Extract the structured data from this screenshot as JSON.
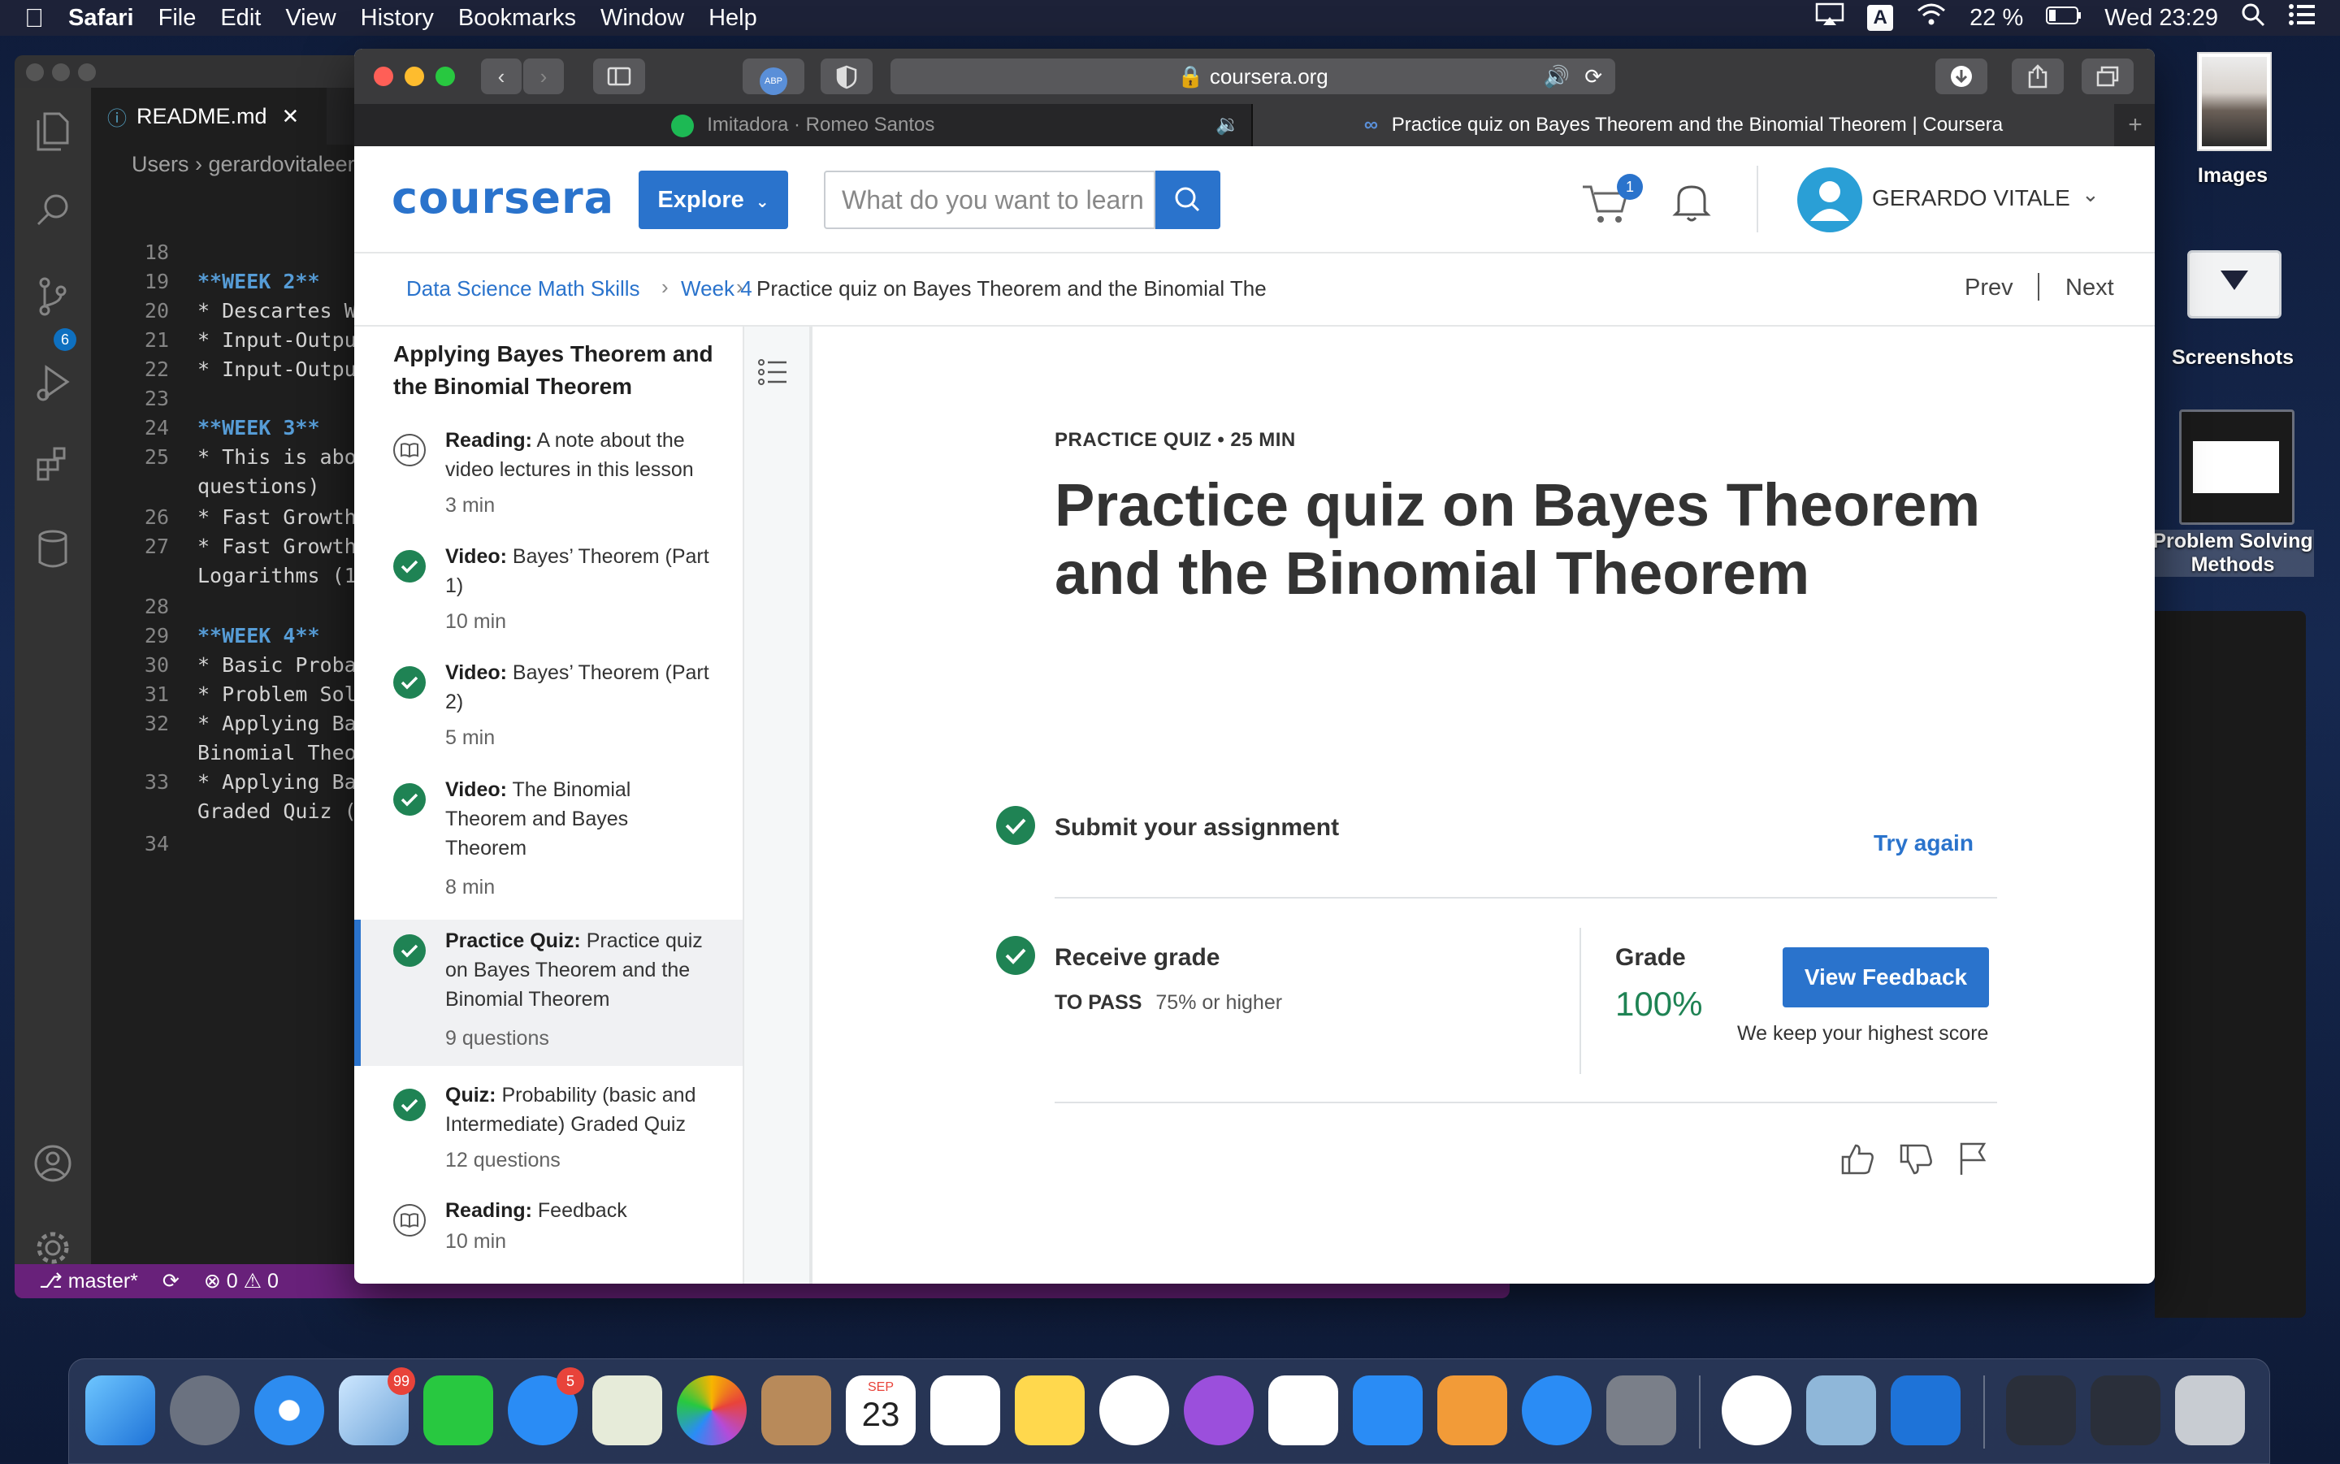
{
  "menubar": {
    "app": "Safari",
    "items": [
      "File",
      "Edit",
      "View",
      "History",
      "Bookmarks",
      "Window",
      "Help"
    ],
    "battery": "22 %",
    "datetime": "Wed 23:29"
  },
  "vscode": {
    "tab_title": "README.md",
    "breadcrumb": "Users › gerardovitaleern",
    "lines": [
      {
        "n": "18",
        "t": "",
        "h": false
      },
      {
        "n": "19",
        "t": "**WEEK 2**",
        "h": true
      },
      {
        "n": "20",
        "t": "* Descartes Wa",
        "h": false
      },
      {
        "n": "21",
        "t": "* Input-Outpu",
        "h": false
      },
      {
        "n": "22",
        "t": "* Input-Outpu",
        "h": false
      },
      {
        "n": "23",
        "t": "",
        "h": false
      },
      {
        "n": "24",
        "t": "**WEEK 3**",
        "h": true
      },
      {
        "n": "25",
        "t": "* This is abo",
        "h": false
      },
      {
        "n": "",
        "t": "questions)",
        "h": false
      },
      {
        "n": "26",
        "t": "* Fast Growth",
        "h": false
      },
      {
        "n": "27",
        "t": "* Fast Growth",
        "h": false
      },
      {
        "n": "",
        "t": "Logarithms (1",
        "h": false
      },
      {
        "n": "28",
        "t": "",
        "h": false
      },
      {
        "n": "29",
        "t": "**WEEK 4**",
        "h": true
      },
      {
        "n": "30",
        "t": "* Basic Probal",
        "h": false
      },
      {
        "n": "31",
        "t": "* Problem Sol",
        "h": false
      },
      {
        "n": "32",
        "t": "* Applying Ba",
        "h": false
      },
      {
        "n": "",
        "t": "Binomial Theo",
        "h": false
      },
      {
        "n": "33",
        "t": "* Applying Ba",
        "h": false
      },
      {
        "n": "",
        "t": "Graded Quiz (",
        "h": false
      },
      {
        "n": "34",
        "t": "",
        "h": false
      }
    ],
    "status_branch": "master*",
    "status_problems": "⊗ 0 ⚠ 0",
    "scm_badge": "6"
  },
  "desktop": {
    "images_label": "Images",
    "screenshots_label": "Screenshots",
    "psm_label": "Problem Solving Methods"
  },
  "safari": {
    "url": "coursera.org",
    "tab1": "Imitadora · Romeo Santos",
    "tab2": "Practice quiz on Bayes Theorem and the Binomial Theorem | Coursera",
    "abp": "ABP"
  },
  "coursera": {
    "logo": "coursera",
    "explore": "Explore",
    "search_placeholder": "What do you want to learn",
    "cart_count": "1",
    "user_name": "GERARDO VITALE",
    "breadcrumb": {
      "course": "Data Science Math Skills",
      "week": "Week 4",
      "current": "Practice quiz on Bayes Theorem and the Binomial The",
      "prev": "Prev",
      "next": "Next"
    },
    "sidebar": {
      "title": "Applying Bayes Theorem and the Binomial Theorem",
      "items": [
        {
          "type": "Reading:",
          "title": "A note about the video lectures in this lesson",
          "dur": "3 min",
          "icon": "book"
        },
        {
          "type": "Video:",
          "title": "Bayes’ Theorem (Part 1)",
          "dur": "10 min",
          "icon": "check"
        },
        {
          "type": "Video:",
          "title": "Bayes’ Theorem (Part 2)",
          "dur": "5 min",
          "icon": "check"
        },
        {
          "type": "Video:",
          "title": "The Binomial Theorem and Bayes Theorem",
          "dur": "8 min",
          "icon": "check"
        },
        {
          "type": "Practice Quiz:",
          "title": "Practice quiz on Bayes Theorem and the Binomial Theorem",
          "dur": "9 questions",
          "icon": "check"
        },
        {
          "type": "Quiz:",
          "title": "Probability (basic and Intermediate) Graded Quiz",
          "dur": "12 questions",
          "icon": "check"
        },
        {
          "type": "Reading:",
          "title": "Feedback",
          "dur": "10 min",
          "icon": "book"
        }
      ]
    },
    "main": {
      "kicker": "PRACTICE QUIZ • 25 MIN",
      "heading": "Practice quiz on Bayes Theorem and the Binomial Theorem",
      "submit_label": "Submit your assignment",
      "try_again": "Try again",
      "receive_label": "Receive grade",
      "to_pass_label": "TO PASS",
      "to_pass_value": "75% or higher",
      "grade_label": "Grade",
      "grade_value": "100%",
      "view_feedback": "View Feedback",
      "keep_note": "We keep your highest score"
    }
  },
  "dock": {
    "mail_badge": "99",
    "messages_badge": "5",
    "calendar_month": "SEP",
    "calendar_day": "23"
  },
  "colors": {
    "coursera_blue": "#2a73cc",
    "success_green": "#1f8354",
    "vscode_status": "#68217a"
  }
}
